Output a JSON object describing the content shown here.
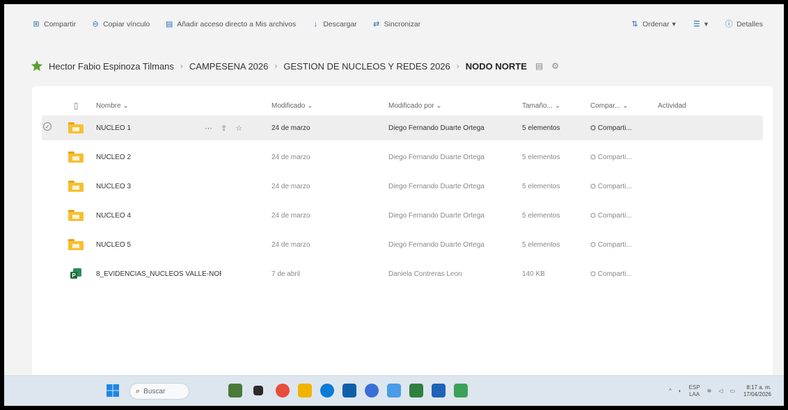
{
  "toolbar": {
    "items": [
      {
        "label": "Compartir",
        "icon": "share-icon"
      },
      {
        "label": "Copiar vínculo",
        "icon": "link-icon"
      },
      {
        "label": "Añadir acceso directo a Mis archivos",
        "icon": "shortcut-icon"
      },
      {
        "label": "Descargar",
        "icon": "download-icon"
      },
      {
        "label": "Sincronizar",
        "icon": "sync-icon"
      }
    ],
    "sort_label": "Ordenar",
    "view_label": "",
    "details_label": "Detalles"
  },
  "breadcrumb": {
    "items": [
      "Hector Fabio Espinoza Tilmans",
      "CAMPESENA 2026",
      "GESTION DE NUCLEOS Y REDES 2026"
    ],
    "current": "NODO NORTE"
  },
  "table": {
    "headers": {
      "name": "Nombre",
      "modified": "Modificado",
      "modified_by": "Modificado por",
      "size": "Tamaño...",
      "sharing": "Compar...",
      "activity": "Actividad"
    },
    "rows": [
      {
        "type": "folder",
        "name": "NÚCLEO 1",
        "modified": "24 de marzo",
        "modified_by": "Diego Fernando Duarte Ortega",
        "size": "5 elementos",
        "sharing": "Comparti..."
      },
      {
        "type": "folder",
        "name": "NÚCLEO 2",
        "modified": "24 de marzo",
        "modified_by": "Diego Fernando Duarte Ortega",
        "size": "5 elementos",
        "sharing": "Comparti..."
      },
      {
        "type": "folder",
        "name": "NÚCLEO 3",
        "modified": "24 de marzo",
        "modified_by": "Diego Fernando Duarte Ortega",
        "size": "5 elementos",
        "sharing": "Comparti..."
      },
      {
        "type": "folder",
        "name": "NÚCLEO 4",
        "modified": "24 de marzo",
        "modified_by": "Diego Fernando Duarte Ortega",
        "size": "5 elementos",
        "sharing": "Comparti..."
      },
      {
        "type": "folder",
        "name": "NÚCLEO 5",
        "modified": "24 de marzo",
        "modified_by": "Diego Fernando Duarte Ortega",
        "size": "5 elementos",
        "sharing": "Comparti..."
      },
      {
        "type": "file",
        "name": "8_EVIDENCIAS_NUCLEOS VALLE-NORT...",
        "modified": "7 de abril",
        "modified_by": "Daniela Contreras Leon",
        "size": "140 KB",
        "sharing": "Comparti..."
      }
    ]
  },
  "taskbar": {
    "search_placeholder": "Buscar",
    "weather": "ESP\nLAA",
    "time": "8:17 a. m.",
    "date": "17/04/2026"
  },
  "colors": {
    "folder": "#f7c032",
    "accent": "#2a6fb7",
    "selected_row": "#eeeeef"
  }
}
